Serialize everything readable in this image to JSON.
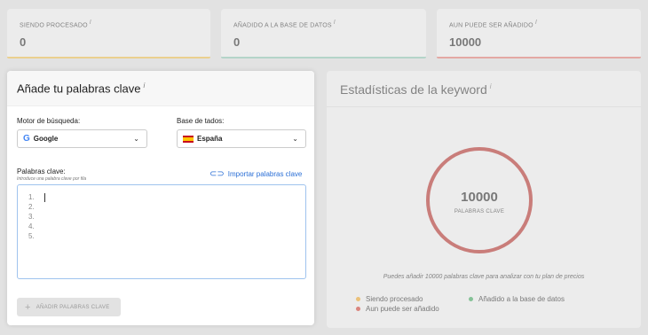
{
  "stats": [
    {
      "label": "SIENDO PROCESADO",
      "info": "i",
      "value": "0",
      "color": "#f3c14b"
    },
    {
      "label": "AÑADIDO A LA BASE DE DATOS",
      "info": "i",
      "value": "0",
      "color": "#8ec9b5"
    },
    {
      "label": "AUN PUEDE SER AÑADIDO",
      "info": "i",
      "value": "10000",
      "color": "#e4786f"
    }
  ],
  "form": {
    "title": "Añade tu palabras clave",
    "info": "i",
    "engine_label": "Motor de búsqueda:",
    "engine_value": "Google",
    "db_label": "Base de tados:",
    "db_value": "España",
    "keywords_label": "Palabras clave:",
    "keywords_sublabel": "Introduce una palabra clave por fila",
    "import_label": "Importar palabras clave",
    "line_numbers": [
      "1.",
      "2.",
      "3.",
      "4.",
      "5."
    ],
    "add_button": "AÑADIR PALABRAS CLAVE"
  },
  "keyword_stats": {
    "title": "Estadísticas de la keyword",
    "info": "i",
    "circle_value": "10000",
    "circle_caption": "PALABRAS CLAVE",
    "plan_note": "Puedes añadir 10000 palabras clave para analizar con tu plan de precios",
    "legend": [
      {
        "label": "Siendo procesado",
        "color": "#f3a623"
      },
      {
        "label": "Añadido a la base de datos",
        "color": "#3aa85a"
      },
      {
        "label": "Aun puede ser añadido",
        "color": "#d33a2c"
      }
    ]
  },
  "icons": {
    "engine": "google-logo-icon",
    "db": "spain-flag-icon",
    "import": "paperclip-icon",
    "dropdown": "chevron-down-icon",
    "add": "plus-icon"
  }
}
